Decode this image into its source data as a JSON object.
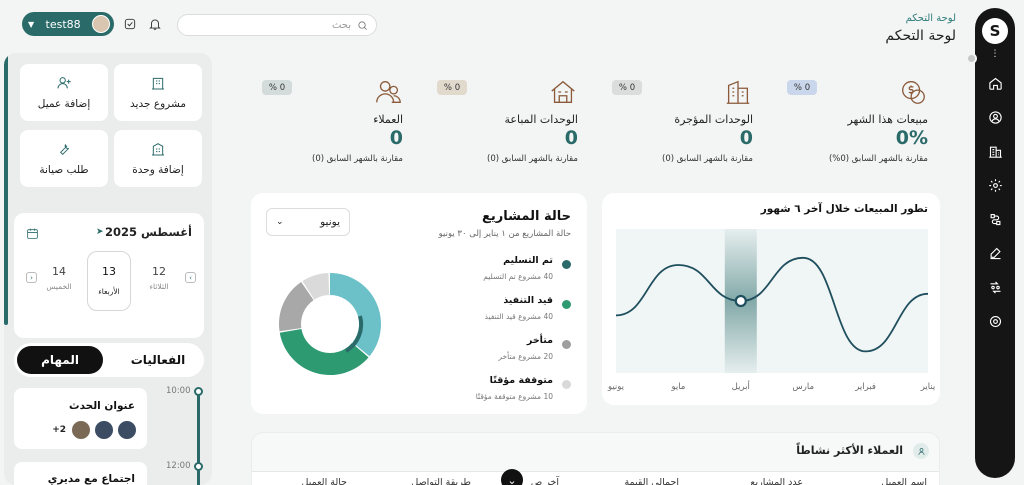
{
  "header": {
    "breadcrumb": "لوحة التحكم",
    "title": "لوحة التحكم",
    "search_placeholder": "بحث",
    "user_name": "test88"
  },
  "quick_actions": [
    {
      "label": "مشروع جديد",
      "icon": "building-icon"
    },
    {
      "label": "إضافة عميل",
      "icon": "add-user-icon"
    },
    {
      "label": "إضافة وحدة",
      "icon": "add-unit-icon"
    },
    {
      "label": "طلب صيانة",
      "icon": "wrench-icon"
    }
  ],
  "calendar": {
    "month": "أغسطس 2025",
    "days": [
      {
        "num": "12",
        "name": "الثلاثاء"
      },
      {
        "num": "13",
        "name": "الأربعاء",
        "selected": true
      },
      {
        "num": "14",
        "name": "الخميس"
      }
    ]
  },
  "tabs": {
    "events": "الفعاليات",
    "tasks": "المهام"
  },
  "timeline": {
    "times": [
      "10:00",
      "12:00"
    ],
    "events": [
      {
        "title": "عنوان الحدث",
        "extra": "2+"
      },
      {
        "title": "اجتماع مع مديري"
      }
    ]
  },
  "kpis": [
    {
      "label": "مبيعات هذا الشهر",
      "value": "0%",
      "compare": "مقارنة بالشهر السابق (0%)",
      "badge": "0 %",
      "bg": "#dde6f4",
      "icon": "money-icon"
    },
    {
      "label": "الوحدات المؤجرة",
      "value": "0",
      "compare": "مقارنة بالشهر السابق (0)",
      "badge": "0 %",
      "bg": "#eaeceb",
      "icon": "office-building-icon"
    },
    {
      "label": "الوحدات المباعة",
      "value": "0",
      "compare": "مقارنة بالشهر السابق (0)",
      "badge": "0 %",
      "bg": "#efeae3",
      "icon": "house-icon"
    },
    {
      "label": "العملاء",
      "value": "0",
      "compare": "مقارنة بالشهر السابق (0)",
      "badge": "0 %",
      "bg": "#e4e9e8",
      "icon": "users-icon"
    }
  ],
  "sales_chart": {
    "title": "تطور المبيعات خلال آخر ٦ شهور"
  },
  "chart_data": {
    "type": "line",
    "title": "تطور المبيعات خلال آخر ٦ شهور",
    "categories": [
      "يناير",
      "فبراير",
      "مارس",
      "أبريل",
      "مايو",
      "يونيو"
    ],
    "values": [
      55,
      15,
      80,
      50,
      75,
      40
    ],
    "highlight_index": 3
  },
  "projects": {
    "title": "حالة المشاريع",
    "subtitle": "حالة المشاريع من ١ يناير إلى ٣٠ يونيو",
    "period": "يونيو",
    "legend": [
      {
        "name": "تم التسليم",
        "detail": "40 مشروع تم التسليم",
        "value": 40,
        "color": "#2a6b6a"
      },
      {
        "name": "قيد التنفيذ",
        "detail": "40 مشروع قيد التنفيذ",
        "value": 40,
        "color": "#2e9a72"
      },
      {
        "name": "متأخر",
        "detail": "20 مشروع متأخر",
        "value": 20,
        "color": "#9e9e9e"
      },
      {
        "name": "متوقفة مؤقتًا",
        "detail": "10 مشروع متوقفة مؤقتًا",
        "value": 10,
        "color": "#d9d9d9"
      }
    ]
  },
  "clients": {
    "title": "العملاء الأكثر نشاطاً",
    "columns": [
      "اسم العميل",
      "عدد المشاريع",
      "اجمالي القيمة",
      "آخر ص",
      "طريقة التواصل",
      "حالة العميل"
    ]
  }
}
